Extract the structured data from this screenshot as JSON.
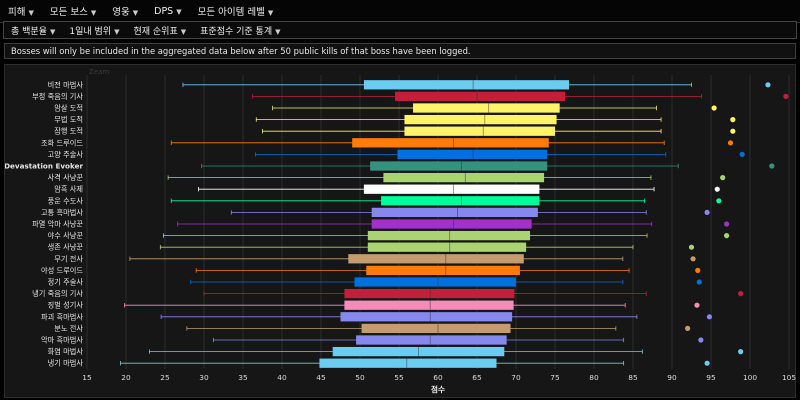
{
  "nav": {
    "items": [
      {
        "label": "피해"
      },
      {
        "label": "모든 보스"
      },
      {
        "label": "영웅"
      },
      {
        "label": "DPS"
      },
      {
        "label": "모든 아이템 레벨"
      }
    ]
  },
  "subnav": {
    "items": [
      {
        "label": "총 백분율"
      },
      {
        "label": "1일내 범위"
      },
      {
        "label": "현재 순위표"
      },
      {
        "label": "표준점수 기준 통계"
      }
    ]
  },
  "notice": "Bosses will only be included in the aggregated data below after 50 public kills of that boss have been logged.",
  "chart_data": {
    "type": "box",
    "watermark": "Zeam",
    "xlabel": "점수",
    "xlim": [
      15,
      105
    ],
    "xticks": [
      15,
      20,
      25,
      30,
      35,
      40,
      45,
      50,
      55,
      60,
      65,
      70,
      75,
      80,
      85,
      90,
      95,
      100,
      105
    ],
    "grid": true,
    "series": [
      {
        "name": "비전 마법사",
        "color": "#69ccf0",
        "min": 27.3,
        "q1": 50.5,
        "median": 64.5,
        "q3": 76.8,
        "max": 92.5,
        "outlier": 102.3
      },
      {
        "name": "부정 죽음의 기사",
        "color": "#c41e3a",
        "min": 36.2,
        "q1": 54.5,
        "median": 65.0,
        "q3": 76.3,
        "max": 93.8,
        "outlier": 104.6
      },
      {
        "name": "암살 도적",
        "color": "#fff468",
        "min": 38.8,
        "q1": 56.8,
        "median": 66.5,
        "q3": 75.6,
        "max": 88.0,
        "outlier": 95.4
      },
      {
        "name": "무법 도적",
        "color": "#fff468",
        "min": 36.7,
        "q1": 55.7,
        "median": 66.0,
        "q3": 75.2,
        "max": 88.6,
        "outlier": 97.8
      },
      {
        "name": "잠행 도적",
        "color": "#fff468",
        "min": 37.5,
        "q1": 55.7,
        "median": 65.8,
        "q3": 75.0,
        "max": 88.6,
        "outlier": 97.8
      },
      {
        "name": "조화 드루이드",
        "color": "#ff7c0a",
        "min": 25.8,
        "q1": 49.0,
        "median": 62.0,
        "q3": 74.2,
        "max": 89.0,
        "outlier": 97.5
      },
      {
        "name": "고양 주술사",
        "color": "#0070dd",
        "min": 36.6,
        "q1": 54.8,
        "median": 64.5,
        "q3": 74.0,
        "max": 89.2,
        "outlier": 99.0
      },
      {
        "name": "Devastation Evoker",
        "color": "#33937f",
        "min": 29.7,
        "q1": 51.3,
        "median": 63.0,
        "q3": 74.0,
        "max": 90.8,
        "outlier": 102.8
      },
      {
        "name": "사격 사냥꾼",
        "color": "#aad372",
        "min": 25.4,
        "q1": 53.0,
        "median": 63.5,
        "q3": 73.6,
        "max": 87.3,
        "outlier": 96.5
      },
      {
        "name": "암흑 사제",
        "color": "#ffffff",
        "min": 29.3,
        "q1": 50.5,
        "median": 62.0,
        "q3": 73.0,
        "max": 87.7,
        "outlier": 95.8
      },
      {
        "name": "풍운 수도사",
        "color": "#00ff98",
        "min": 25.8,
        "q1": 52.7,
        "median": 63.0,
        "q3": 73.0,
        "max": 86.5,
        "outlier": 96.0
      },
      {
        "name": "고통 흑마법사",
        "color": "#8788ee",
        "min": 33.5,
        "q1": 51.5,
        "median": 62.5,
        "q3": 72.8,
        "max": 86.7,
        "outlier": 94.5
      },
      {
        "name": "파멸 악마 사냥꾼",
        "color": "#a330c9",
        "min": 26.6,
        "q1": 51.5,
        "median": 62.0,
        "q3": 72.0,
        "max": 87.4,
        "outlier": 97.0
      },
      {
        "name": "야수 사냥꾼",
        "color": "#aad372",
        "min": 24.8,
        "q1": 51.0,
        "median": 61.5,
        "q3": 71.8,
        "max": 86.8,
        "outlier": 97.0
      },
      {
        "name": "생존 사냥꾼",
        "color": "#aad372",
        "min": 24.4,
        "q1": 51.0,
        "median": 61.5,
        "q3": 71.3,
        "max": 85.0,
        "outlier": 92.5
      },
      {
        "name": "무기 전사",
        "color": "#c69b6d",
        "min": 20.5,
        "q1": 48.5,
        "median": 61.0,
        "q3": 71.0,
        "max": 83.7,
        "outlier": 92.7
      },
      {
        "name": "야성 드루이드",
        "color": "#ff7c0a",
        "min": 29.0,
        "q1": 50.8,
        "median": 61.0,
        "q3": 70.5,
        "max": 84.5,
        "outlier": 93.3
      },
      {
        "name": "정기 주술사",
        "color": "#0070dd",
        "min": 28.3,
        "q1": 49.3,
        "median": 60.0,
        "q3": 70.0,
        "max": 83.7,
        "outlier": 93.5
      },
      {
        "name": "냉기 죽음의 기사",
        "color": "#c41e3a",
        "min": 30.0,
        "q1": 48.0,
        "median": 59.0,
        "q3": 69.8,
        "max": 86.7,
        "outlier": 98.8
      },
      {
        "name": "징벌 성기사",
        "color": "#f48cba",
        "min": 19.8,
        "q1": 48.0,
        "median": 59.0,
        "q3": 69.7,
        "max": 84.0,
        "outlier": 93.2
      },
      {
        "name": "파괴 흑마법사",
        "color": "#8788ee",
        "min": 24.5,
        "q1": 47.5,
        "median": 59.0,
        "q3": 69.5,
        "max": 85.5,
        "outlier": 94.8
      },
      {
        "name": "분노 전사",
        "color": "#c69b6d",
        "min": 27.8,
        "q1": 50.2,
        "median": 60.0,
        "q3": 69.3,
        "max": 82.8,
        "outlier": 92.0
      },
      {
        "name": "악마 흑마법사",
        "color": "#8788ee",
        "min": 31.2,
        "q1": 49.5,
        "median": 59.0,
        "q3": 68.8,
        "max": 83.8,
        "outlier": 93.7
      },
      {
        "name": "화염 마법사",
        "color": "#69ccf0",
        "min": 23.0,
        "q1": 46.5,
        "median": 57.5,
        "q3": 68.5,
        "max": 86.2,
        "outlier": 98.8
      },
      {
        "name": "냉기 마법사",
        "color": "#69ccf0",
        "min": 19.3,
        "q1": 44.8,
        "median": 56.0,
        "q3": 67.5,
        "max": 83.8,
        "outlier": 94.5
      }
    ]
  }
}
